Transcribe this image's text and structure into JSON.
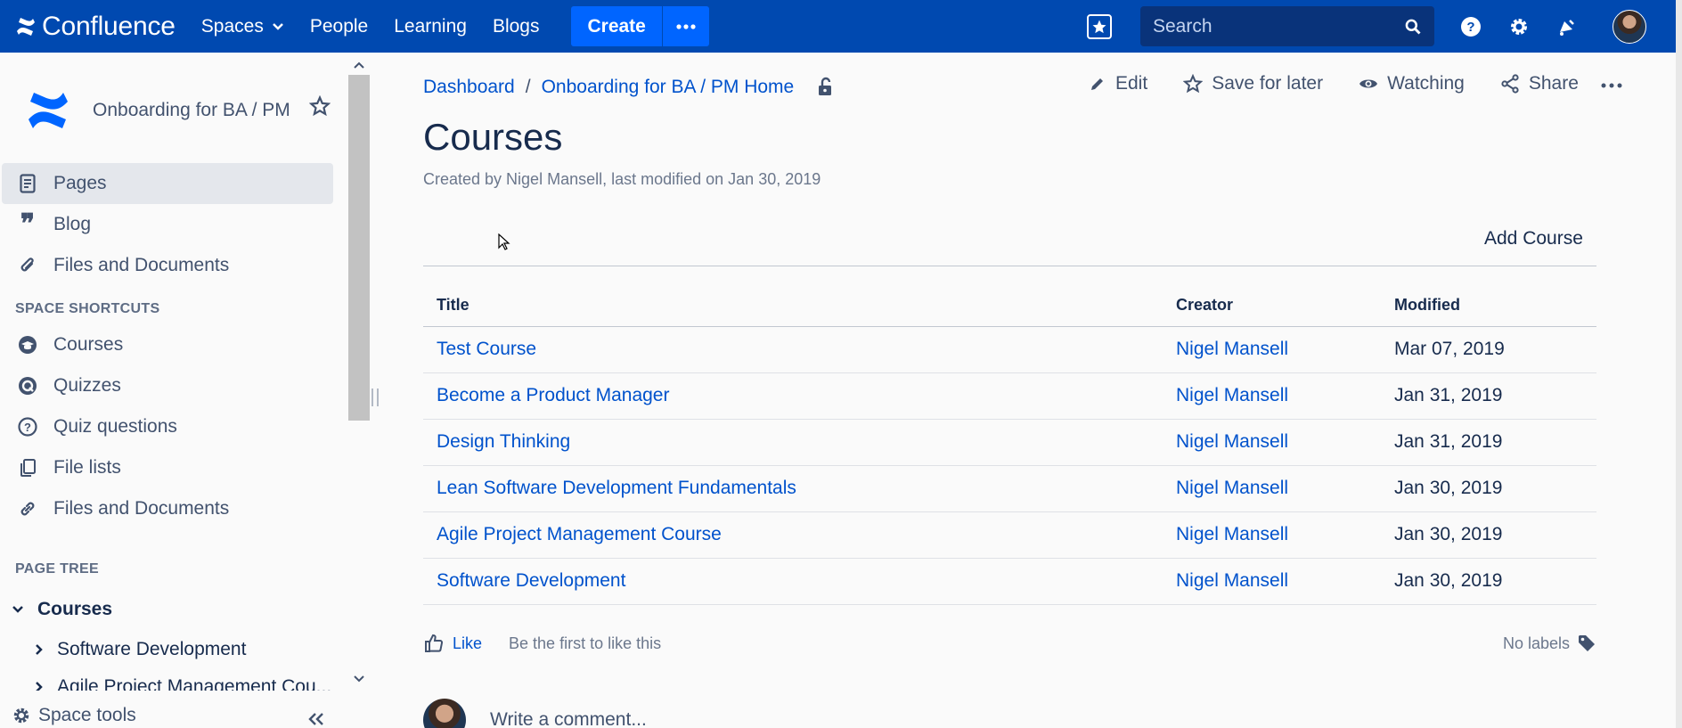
{
  "app": {
    "name": "Confluence"
  },
  "nav": {
    "links": [
      "Spaces",
      "People",
      "Learning",
      "Blogs"
    ],
    "create_label": "Create",
    "search_placeholder": "Search"
  },
  "sidebar": {
    "space_name": "Onboarding for BA / PM",
    "items": [
      {
        "label": "Pages",
        "icon": "page-icon",
        "active": true
      },
      {
        "label": "Blog",
        "icon": "quote-icon"
      },
      {
        "label": "Files and Documents",
        "icon": "paperclip-icon"
      }
    ],
    "shortcuts_title": "SPACE SHORTCUTS",
    "shortcuts": [
      {
        "label": "Courses",
        "icon": "graduation-cap-icon"
      },
      {
        "label": "Quizzes",
        "icon": "quiz-icon"
      },
      {
        "label": "Quiz questions",
        "icon": "question-icon"
      },
      {
        "label": "File lists",
        "icon": "copy-icon"
      },
      {
        "label": "Files and Documents",
        "icon": "link-icon"
      }
    ],
    "page_tree_title": "PAGE TREE",
    "tree": {
      "root": "Courses",
      "children": [
        "Software Development",
        "Agile Project Management Cou..."
      ]
    },
    "space_tools": "Space tools"
  },
  "breadcrumb": [
    "Dashboard",
    "Onboarding for BA / PM Home"
  ],
  "actions": {
    "edit": "Edit",
    "save_for_later": "Save for later",
    "watching": "Watching",
    "share": "Share"
  },
  "page": {
    "title": "Courses",
    "byline": "Created by Nigel Mansell, last modified on Jan 30, 2019",
    "add_course": "Add Course"
  },
  "table": {
    "headers": [
      "Title",
      "Creator",
      "Modified"
    ],
    "rows": [
      {
        "title": "Test Course",
        "creator": "Nigel Mansell",
        "modified": "Mar 07, 2019"
      },
      {
        "title": "Become a Product Manager",
        "creator": "Nigel Mansell",
        "modified": "Jan 31, 2019"
      },
      {
        "title": "Design Thinking",
        "creator": "Nigel Mansell",
        "modified": "Jan 31, 2019"
      },
      {
        "title": "Lean Software Development Fundamentals",
        "creator": "Nigel Mansell",
        "modified": "Jan 30, 2019"
      },
      {
        "title": "Agile Project Management Course",
        "creator": "Nigel Mansell",
        "modified": "Jan 30, 2019"
      },
      {
        "title": "Software Development",
        "creator": "Nigel Mansell",
        "modified": "Jan 30, 2019"
      }
    ]
  },
  "footer": {
    "like": "Like",
    "first_like": "Be the first to like this",
    "no_labels": "No labels",
    "comment_placeholder": "Write a comment..."
  },
  "colors": {
    "nav_bg": "#0049b0",
    "create": "#0065ff",
    "link": "#0052cc",
    "text": "#172b4d"
  }
}
